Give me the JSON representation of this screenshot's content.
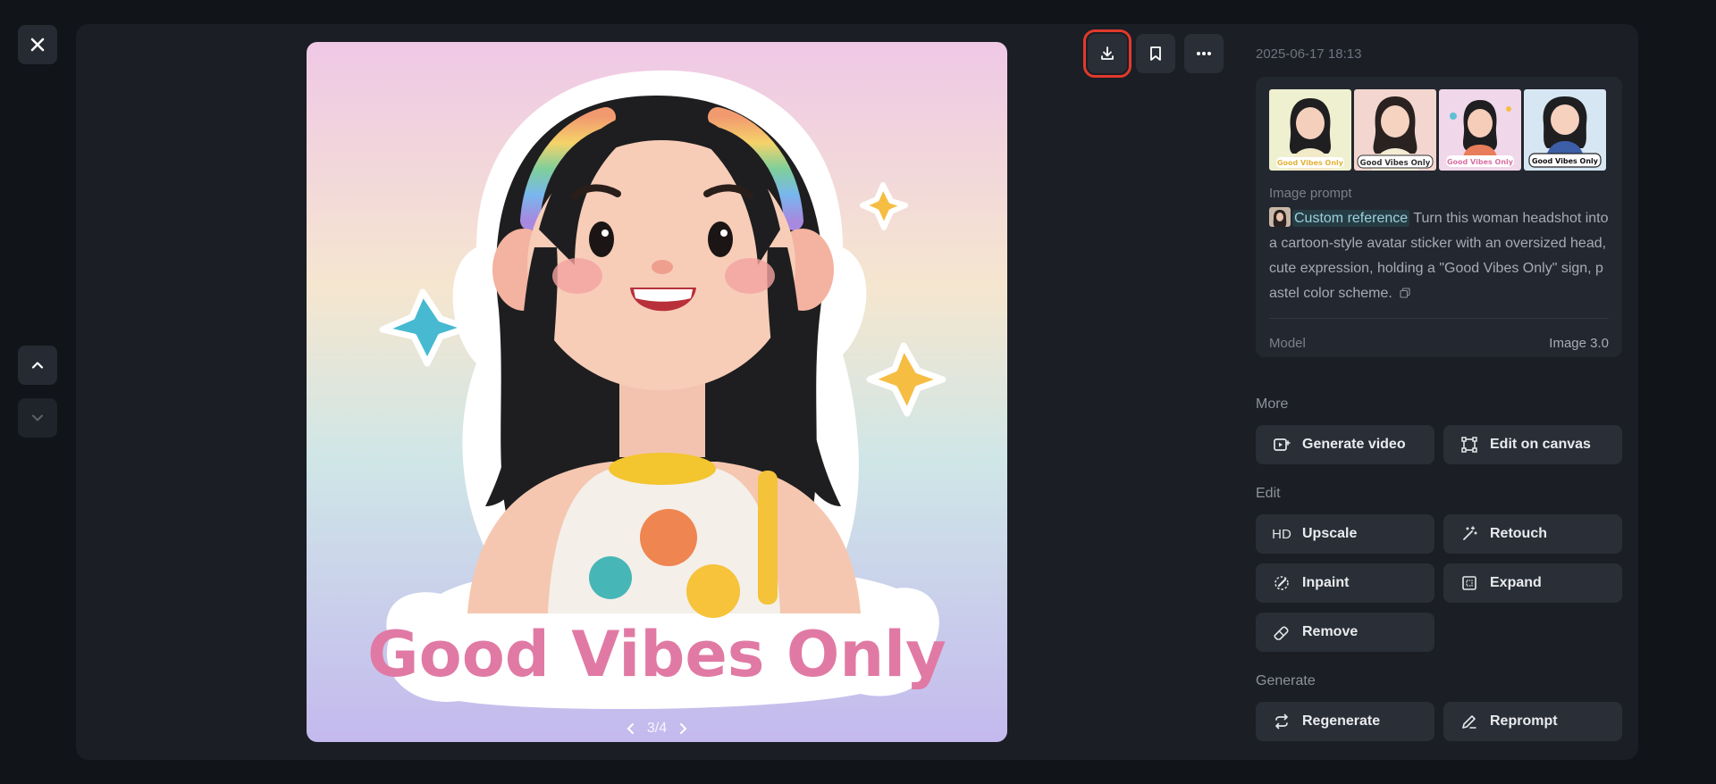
{
  "icons": {
    "close": "close-icon",
    "up": "chevron-up-icon",
    "down": "chevron-down-icon",
    "download": "download-icon",
    "bookmark": "bookmark-icon",
    "more": "more-icon"
  },
  "image": {
    "sign_text": "Good Vibes Only",
    "pager": "3/4"
  },
  "details": {
    "date": "2025-06-17 18:13",
    "thumbnails": [
      {
        "sign": "Good Vibes Only"
      },
      {
        "sign": "Good Vibes Only"
      },
      {
        "sign": "Good Vibes Only"
      },
      {
        "sign": "Good Vibes Only"
      }
    ],
    "prompt_label": "Image prompt",
    "custom_reference": "Custom reference",
    "prompt_text": " Turn this woman headshot into a cartoon-style avatar sticker with an oversized head, cute expression, holding a \"Good Vibes Only\" sign, pastel color scheme.",
    "model_label": "Model",
    "model_value": "Image 3.0"
  },
  "sections": {
    "more": "More",
    "edit": "Edit",
    "generate": "Generate"
  },
  "actions": {
    "generate_video": "Generate video",
    "edit_on_canvas": "Edit on canvas",
    "upscale": "Upscale",
    "upscale_icon_text": "HD",
    "retouch": "Retouch",
    "inpaint": "Inpaint",
    "expand": "Expand",
    "remove": "Remove",
    "regenerate": "Regenerate",
    "reprompt": "Reprompt"
  },
  "colors": {
    "background": "#111419",
    "panel": "#1b1e25",
    "button": "#2a2e36",
    "highlight": "#e03a2b",
    "sign_pink": "#e07aa4"
  }
}
